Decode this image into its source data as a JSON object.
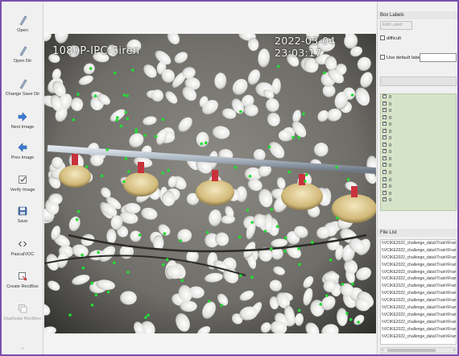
{
  "toolbar": {
    "items": [
      {
        "label": "Open",
        "icon": "open-icon"
      },
      {
        "label": "Open Dir",
        "icon": "open-dir-icon"
      },
      {
        "label": "Change Save Dir",
        "icon": "change-save-dir-icon"
      },
      {
        "label": "Next Image",
        "icon": "next-image-icon"
      },
      {
        "label": "Prev Image",
        "icon": "prev-image-icon"
      },
      {
        "label": "Verify Image",
        "icon": "verify-image-icon"
      },
      {
        "label": "Save",
        "icon": "save-icon"
      },
      {
        "label": "PascalVOC",
        "icon": "format-icon"
      },
      {
        "label": "Create RectBox",
        "icon": "create-rectbox-icon"
      },
      {
        "label": "Duplicate RectBox",
        "icon": "duplicate-rectbox-icon"
      }
    ]
  },
  "canvas": {
    "osd_title": "1080P-IPC-Siren",
    "osd_timestamp": "2022-03-04 23:03:17"
  },
  "box_labels": {
    "title": "Box Labels",
    "edit_label_button": "Edit Label",
    "difficult_label": "difficult",
    "use_default_label": "Use default label",
    "default_label_value": "",
    "labels": [
      "0",
      "0",
      "0",
      "0",
      "0",
      "0",
      "0",
      "0",
      "0",
      "0",
      "0",
      "0",
      "0",
      "0",
      "0",
      "0"
    ]
  },
  "file_list": {
    "title": "File List",
    "files": [
      "\\\\VCIKE2022_challenge_data\\\\Train\\\\Frames\\\\",
      "\\\\VCIKE2022_challenge_data\\\\Train\\\\Frames\\\\",
      "\\\\VCIKE2022_challenge_data\\\\Train\\\\Frames\\\\",
      "\\\\VCIKE2022_challenge_data\\\\Train\\\\Frames\\\\",
      "\\\\VCIKE2022_challenge_data\\\\Train\\\\Frames\\\\",
      "\\\\VCIKE2022_challenge_data\\\\Train\\\\Frames\\\\",
      "\\\\VCIKE2022_challenge_data\\\\Train\\\\Frames\\\\",
      "\\\\VCIKE2022_challenge_data\\\\Train\\\\Frames\\\\",
      "\\\\VCIKE2022_challenge_data\\\\Train\\\\Frames\\\\",
      "\\\\VCIKE2022_challenge_data\\\\Train\\\\Frames\\\\",
      "\\\\VCIKE2022_challenge_data\\\\Train\\\\Frames\\\\",
      "\\\\VCIKE2022_challenge_data\\\\Train\\\\Frames\\\\",
      "\\\\VCIKE2022_challenge_data\\\\Train\\\\Frames\\\\",
      "\\\\VCIKE2022_challenge_data\\\\Train\\\\Frames\\\\"
    ]
  },
  "colors": {
    "accent_frame": "#7b4fb0",
    "label_list_bg": "#d5e4c8",
    "annotation_point": "#22dd33",
    "feeder_red": "#c8323c"
  }
}
